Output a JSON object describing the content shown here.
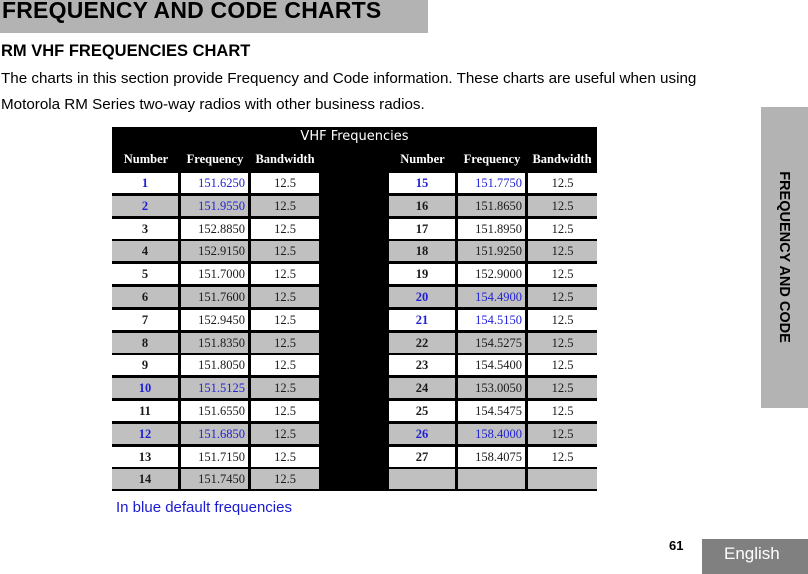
{
  "chapter": {
    "title": "FREQUENCY AND CODE CHARTS"
  },
  "section": {
    "title": "RM VHF FREQUENCIES CHART",
    "intro": "The charts in this section provide Frequency and Code information. These charts are useful when using Motorola RM Series two-way radios with other business radios."
  },
  "side_tab": {
    "label": "FREQUENCY AND CODE"
  },
  "footer": {
    "page_number": "61",
    "language": "English"
  },
  "table": {
    "title": "VHF Frequencies",
    "headers": [
      "Number",
      "Frequency",
      "Bandwidth"
    ],
    "highlight_color": "#1f1fd6",
    "left_rows": [
      {
        "number": "1",
        "frequency": "151.6250",
        "bandwidth": "12.5",
        "default": true
      },
      {
        "number": "2",
        "frequency": "151.9550",
        "bandwidth": "12.5",
        "default": true
      },
      {
        "number": "3",
        "frequency": "152.8850",
        "bandwidth": "12.5",
        "default": false
      },
      {
        "number": "4",
        "frequency": "152.9150",
        "bandwidth": "12.5",
        "default": false
      },
      {
        "number": "5",
        "frequency": "151.7000",
        "bandwidth": "12.5",
        "default": false
      },
      {
        "number": "6",
        "frequency": "151.7600",
        "bandwidth": "12.5",
        "default": false
      },
      {
        "number": "7",
        "frequency": "152.9450",
        "bandwidth": "12.5",
        "default": false
      },
      {
        "number": "8",
        "frequency": "151.8350",
        "bandwidth": "12.5",
        "default": false
      },
      {
        "number": "9",
        "frequency": "151.8050",
        "bandwidth": "12.5",
        "default": false
      },
      {
        "number": "10",
        "frequency": "151.5125",
        "bandwidth": "12.5",
        "default": true
      },
      {
        "number": "11",
        "frequency": "151.6550",
        "bandwidth": "12.5",
        "default": false
      },
      {
        "number": "12",
        "frequency": "151.6850",
        "bandwidth": "12.5",
        "default": true
      },
      {
        "number": "13",
        "frequency": "151.7150",
        "bandwidth": "12.5",
        "default": false
      },
      {
        "number": "14",
        "frequency": "151.7450",
        "bandwidth": "12.5",
        "default": false
      }
    ],
    "right_rows": [
      {
        "number": "15",
        "frequency": "151.7750",
        "bandwidth": "12.5",
        "default": true
      },
      {
        "number": "16",
        "frequency": "151.8650",
        "bandwidth": "12.5",
        "default": false
      },
      {
        "number": "17",
        "frequency": "151.8950",
        "bandwidth": "12.5",
        "default": false
      },
      {
        "number": "18",
        "frequency": "151.9250",
        "bandwidth": "12.5",
        "default": false
      },
      {
        "number": "19",
        "frequency": "152.9000",
        "bandwidth": "12.5",
        "default": false
      },
      {
        "number": "20",
        "frequency": "154.4900",
        "bandwidth": "12.5",
        "default": true
      },
      {
        "number": "21",
        "frequency": "154.5150",
        "bandwidth": "12.5",
        "default": true
      },
      {
        "number": "22",
        "frequency": "154.5275",
        "bandwidth": "12.5",
        "default": false
      },
      {
        "number": "23",
        "frequency": "154.5400",
        "bandwidth": "12.5",
        "default": false
      },
      {
        "number": "24",
        "frequency": "153.0050",
        "bandwidth": "12.5",
        "default": false
      },
      {
        "number": "25",
        "frequency": "154.5475",
        "bandwidth": "12.5",
        "default": false
      },
      {
        "number": "26",
        "frequency": "158.4000",
        "bandwidth": "12.5",
        "default": true
      },
      {
        "number": "27",
        "frequency": "158.4075",
        "bandwidth": "12.5",
        "default": false
      },
      {
        "number": "",
        "frequency": "",
        "bandwidth": "",
        "default": false
      }
    ],
    "legend": "In blue default frequencies"
  }
}
